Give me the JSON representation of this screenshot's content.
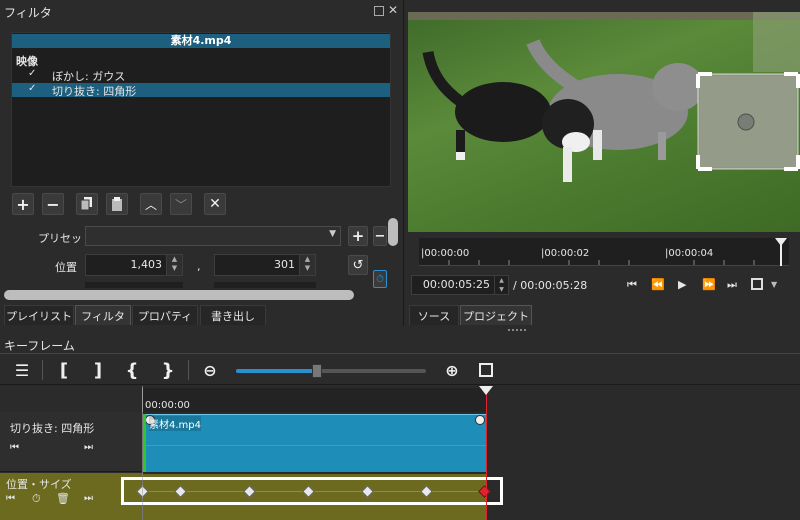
{
  "filter_panel": {
    "title": "フィルタ",
    "clip_name": "素材4.mp4",
    "category": "映像",
    "filters": [
      {
        "check": "✓",
        "name": "ぼかし: ガウス"
      },
      {
        "check": "✓",
        "name": "切り抜き: 四角形"
      }
    ],
    "preset_label": "プリセット",
    "position_label": "位置",
    "position_x": "1,403",
    "position_y": "301",
    "comma": ","
  },
  "panel_tabs": {
    "playlist": "プレイリスト",
    "filters": "フィルタ",
    "properties": "プロパティ",
    "export": "書き出し"
  },
  "player": {
    "ruler_labels": [
      "|00:00:00",
      "|00:00:02",
      "|00:00:04"
    ],
    "current_time": "00:00:05:25",
    "total_time": "/ 00:00:05:28",
    "tab_source": "ソース",
    "tab_project": "プロジェクト"
  },
  "keyframes": {
    "title": "キーフレーム",
    "ruler_label": "00:00:00",
    "track1_name": "切り抜き: 四角形",
    "clip_label": "素材4.mp4",
    "track2_name": "位置・サイズ"
  },
  "colors": {
    "accent": "#1d5f7e",
    "track_clip": "#1e8db8",
    "param_track": "#6b6a1e",
    "playhead": "#e0242f"
  }
}
